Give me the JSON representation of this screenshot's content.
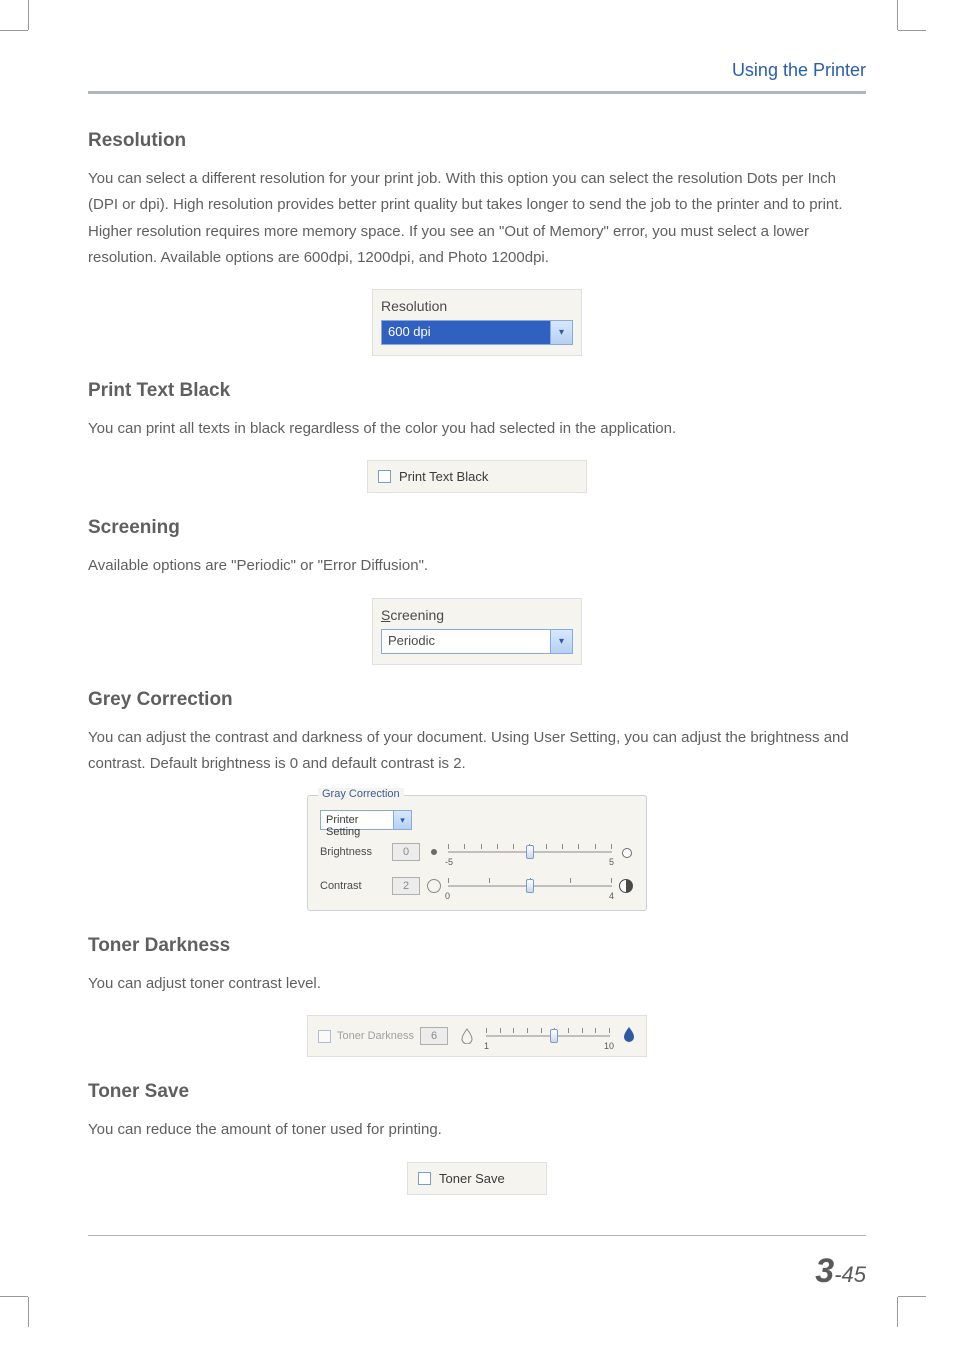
{
  "header": {
    "section": "Using the Printer"
  },
  "resolution": {
    "heading": "Resolution",
    "body": "You can select a different resolution for your print job. With this option you can select the resolution Dots per Inch (DPI or dpi). High resolution provides better print quality but takes longer to send the job to the printer and to print. Higher resolution requires more memory space. If you see an \"Out of Memory\" error, you must select a lower resolution. Available options are 600dpi, 1200dpi, and Photo 1200dpi.",
    "figure": {
      "label": "Resolution",
      "value": "600 dpi"
    }
  },
  "print_text_black": {
    "heading": "Print Text Black",
    "body": "You can print all texts in black regardless of the color you had selected in the application.",
    "figure": {
      "label": "Print Text Black"
    }
  },
  "screening": {
    "heading": "Screening",
    "body": "Available options are \"Periodic\" or \"Error Diffusion\".",
    "figure": {
      "label_prefix": "S",
      "label_rest": "creening",
      "value": "Periodic"
    }
  },
  "grey_correction": {
    "heading": "Grey Correction",
    "body": "You can adjust the contrast and darkness of your document. Using User Setting, you can adjust the brightness and contrast. Default brightness is 0 and default contrast is 2.",
    "figure": {
      "legend": "Gray Correction",
      "setting_value": "Printer Setting",
      "brightness_label": "Brightness",
      "brightness_value": "0",
      "brightness_min": "-5",
      "brightness_max": "5",
      "contrast_label": "Contrast",
      "contrast_value": "2",
      "contrast_min": "0",
      "contrast_max": "4"
    }
  },
  "toner_darkness": {
    "heading": "Toner Darkness",
    "body": "You can adjust toner contrast level.",
    "figure": {
      "label": "Toner Darkness",
      "value": "6",
      "min": "1",
      "max": "10"
    }
  },
  "toner_save": {
    "heading": "Toner Save",
    "body": "You can reduce the amount of toner used for printing.",
    "figure": {
      "label": "Toner Save"
    }
  },
  "footer": {
    "chapter": "3",
    "page": "-45"
  }
}
